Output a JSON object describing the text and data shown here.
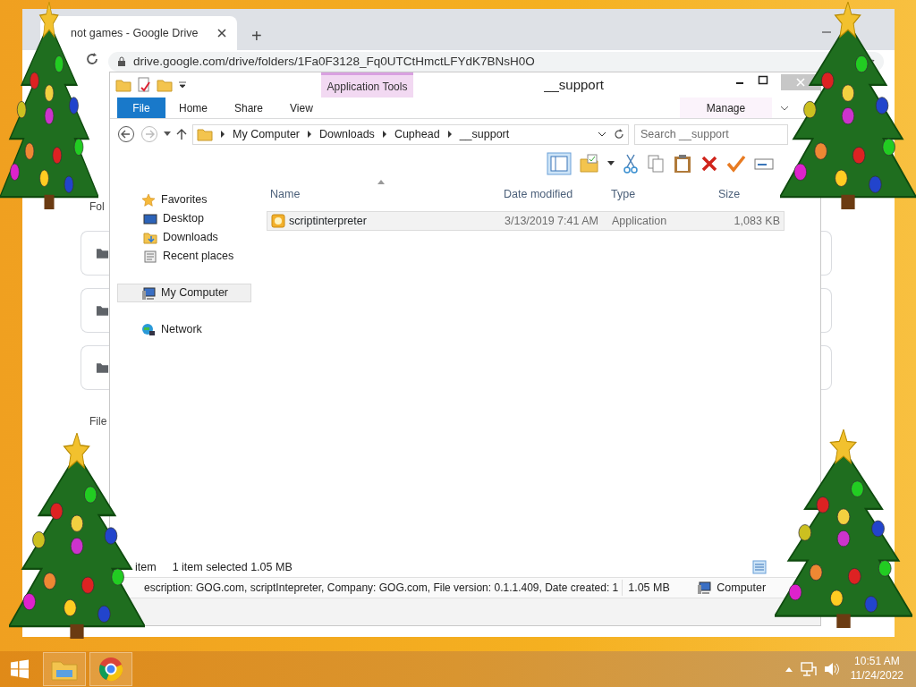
{
  "browser": {
    "tab": {
      "title": "not games - Google Drive"
    },
    "new_tab": "+",
    "address": "drive.google.com/drive/folders/1Fa0F3128_Fq0UTCtHmctLFYdK7BNsH0O",
    "page": {
      "sections": [
        {
          "label": "Fol"
        },
        {
          "label": "File"
        }
      ]
    }
  },
  "explorer": {
    "context_tab": "Application Tools",
    "title": "__support",
    "ribbon_tabs": [
      {
        "label": "File",
        "kind": "file"
      },
      {
        "label": "Home",
        "kind": "tab"
      },
      {
        "label": "Share",
        "kind": "tab"
      },
      {
        "label": "View",
        "kind": "tab"
      },
      {
        "label": "Manage",
        "kind": "context"
      }
    ],
    "breadcrumb": [
      "My Computer",
      "Downloads",
      "Cuphead",
      "__support"
    ],
    "search": {
      "placeholder": "Search __support"
    },
    "nav": [
      {
        "label": "Favorites",
        "kind": "favorites",
        "selected": false,
        "children": [
          {
            "label": "Desktop",
            "kind": "desktop",
            "selected": false
          },
          {
            "label": "Downloads",
            "kind": "downloads",
            "selected": false
          },
          {
            "label": "Recent places",
            "kind": "recent",
            "selected": false
          }
        ]
      },
      {
        "label": "My Computer",
        "kind": "computer",
        "selected": true
      },
      {
        "label": "Network",
        "kind": "network",
        "selected": false
      }
    ],
    "columns": [
      "Name",
      "Date modified",
      "Type",
      "Size"
    ],
    "rows": [
      {
        "name": "scriptinterpreter",
        "date": "3/13/2019 7:41 AM",
        "type": "Application",
        "size": "1,083 KB",
        "selected": true
      }
    ],
    "status": {
      "count": "item",
      "selection": "1 item selected  1.05 MB"
    },
    "details": {
      "text": "escription: GOG.com, scriptIntepreter, Company: GOG.com, File version: 0.1.1.409, Date created: 1",
      "size": "1.05 MB",
      "location": "Computer"
    }
  },
  "taskbar": {
    "clock": {
      "time": "10:51 AM",
      "date": "11/24/2022"
    }
  }
}
